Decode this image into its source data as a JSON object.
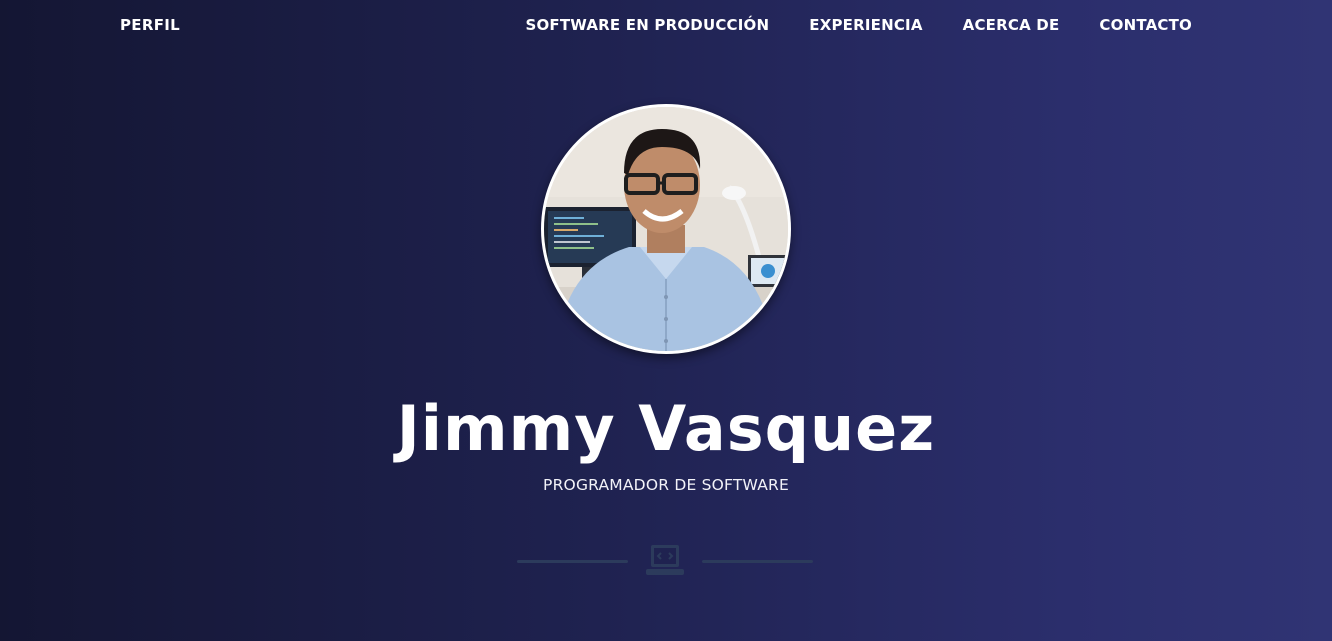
{
  "nav": {
    "brand": "PERFIL",
    "items": [
      {
        "label": "SOFTWARE EN PRODUCCIÓN"
      },
      {
        "label": "EXPERIENCIA"
      },
      {
        "label": "ACERCA DE"
      },
      {
        "label": "CONTACTO"
      }
    ]
  },
  "hero": {
    "name": "Jimmy Vasquez",
    "subtitle": "PROGRAMADOR DE SOFTWARE",
    "divider_icon": "laptop-code-icon"
  },
  "colors": {
    "background_start": "#141633",
    "background_end": "#303474",
    "text": "#ffffff",
    "divider": "#2c3b5c"
  }
}
